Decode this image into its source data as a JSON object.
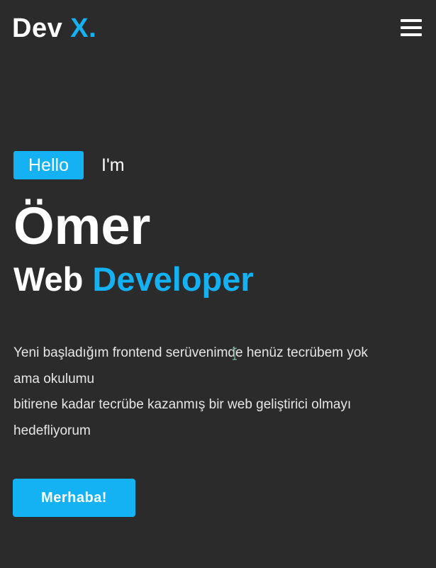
{
  "colors": {
    "background": "#2b2b2c",
    "accent": "#14b1f3",
    "text": "#ffffff"
  },
  "navbar": {
    "logo_main": "Dev ",
    "logo_accent": "X.",
    "menu_icon": "hamburger-menu-icon"
  },
  "hero": {
    "hello_badge": "Hello",
    "im": "I'm",
    "name": "Ömer",
    "role_prefix": "Web ",
    "role_accent": "Developer",
    "description_lines": [
      "Yeni başladığım frontend serüvenimde henüz tecrübem yok",
      "ama okulumu",
      "bitirene kadar tecrübe kazanmış bir web geliştirici olmayı",
      "hedefliyorum"
    ],
    "cta_label": "Merhaba!"
  }
}
